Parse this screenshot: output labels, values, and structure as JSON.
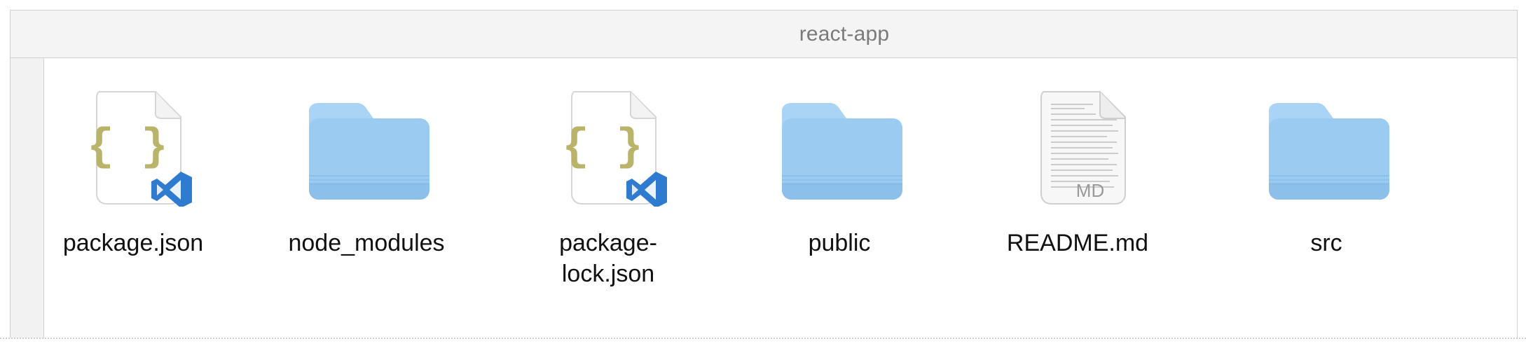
{
  "window": {
    "title": "react-app"
  },
  "items": [
    {
      "name": "package.json",
      "kind": "json-file",
      "icon": "json-vscode-file-icon",
      "badge_text": ""
    },
    {
      "name": "node_modules",
      "kind": "folder",
      "icon": "folder-icon",
      "badge_text": ""
    },
    {
      "name": "package-lock.json",
      "kind": "json-file",
      "icon": "json-vscode-file-icon",
      "badge_text": ""
    },
    {
      "name": "public",
      "kind": "folder",
      "icon": "folder-icon",
      "badge_text": ""
    },
    {
      "name": "README.md",
      "kind": "markdown-file",
      "icon": "markdown-file-icon",
      "badge_text": "MD"
    },
    {
      "name": "src",
      "kind": "folder",
      "icon": "folder-icon",
      "badge_text": ""
    }
  ],
  "colors": {
    "title_text": "#7a7a7a",
    "titlebar_bg": "#f4f4f4",
    "folder_main": "#9ccbf2",
    "folder_top": "#a9d4f6",
    "folder_bottom": "#7fb6e3",
    "json_braces": "#b9b46a",
    "vscode_blue": "#2f7bcf"
  }
}
